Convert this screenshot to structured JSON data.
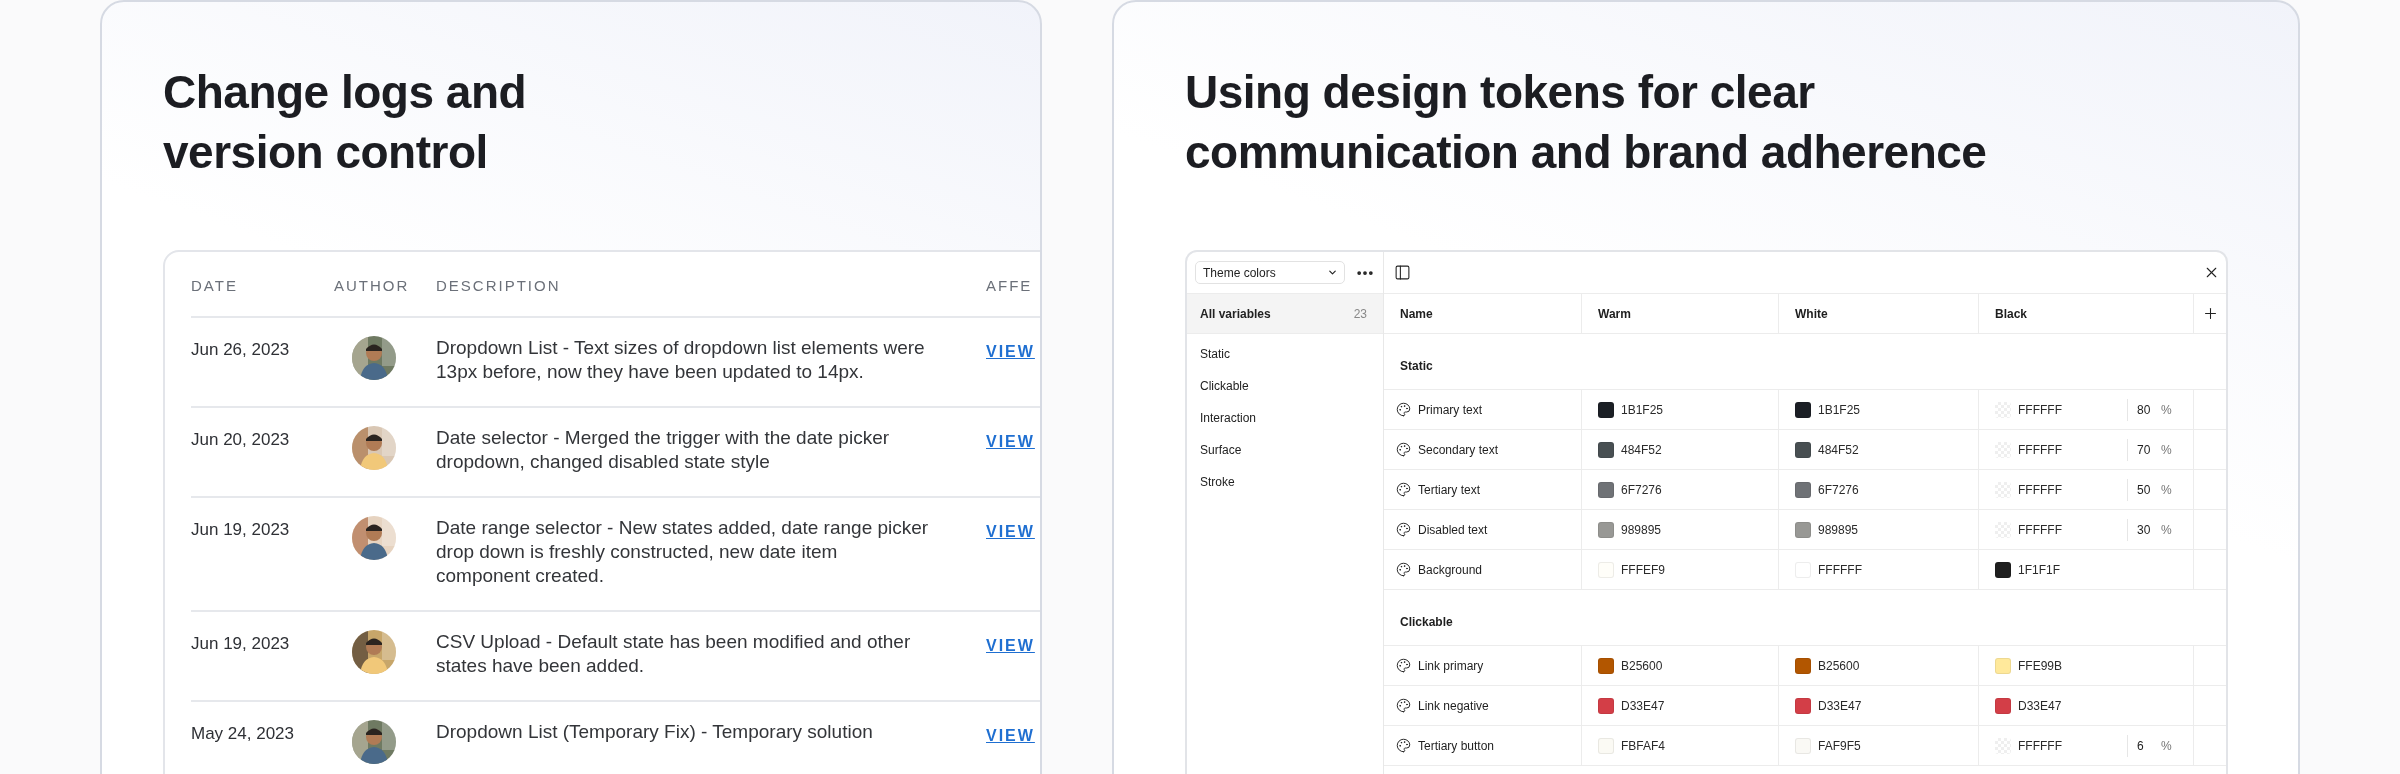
{
  "changelog": {
    "title": [
      "Change logs and",
      "version control"
    ],
    "columns": [
      "DATE",
      "AUTHOR",
      "DESCRIPTION",
      "AFFE"
    ],
    "rows": [
      {
        "date": "Jun 26, 2023",
        "description": "Dropdown List - Text sizes of dropdown list elements were 13px before, now they have been updated to 14px.",
        "link": "VIEW"
      },
      {
        "date": "Jun 20, 2023",
        "description": "Date selector - Merged the trigger with the date picker dropdown, changed disabled state style",
        "link": "VIEW"
      },
      {
        "date": "Jun 19, 2023",
        "description": "Date range selector - New states added, date range picker drop down is freshly constructed, new date item component created.",
        "link": "VIEW"
      },
      {
        "date": "Jun 19, 2023",
        "description": "CSV Upload - Default state has been modified and other states have been added.",
        "link": "VIEW"
      },
      {
        "date": "May 24, 2023",
        "description": "Dropdown List (Temporary Fix) - Temporary solution",
        "link": "VIEW"
      }
    ]
  },
  "tokens": {
    "title": [
      "Using design tokens for clear",
      "communication and brand adherence"
    ],
    "collection": "Theme colors",
    "sidebar": [
      {
        "label": "All variables",
        "count": "23",
        "selected": true
      },
      {
        "label": "Static",
        "selected": false
      },
      {
        "label": "Clickable",
        "selected": false
      },
      {
        "label": "Interaction",
        "selected": false
      },
      {
        "label": "Surface",
        "selected": false
      },
      {
        "label": "Stroke",
        "selected": false
      }
    ],
    "columns": [
      "Name",
      "Warm",
      "White",
      "Black"
    ],
    "groups": [
      {
        "title": "Static",
        "rows": [
          {
            "name": "Primary text",
            "values": [
              {
                "hex": "1B1F25",
                "color": "#1b1f25"
              },
              {
                "hex": "1B1F25",
                "color": "#1b1f25"
              },
              {
                "hex": "FFFFFF",
                "alpha": "80",
                "unit": "%"
              }
            ]
          },
          {
            "name": "Secondary text",
            "values": [
              {
                "hex": "484F52",
                "color": "#484f52"
              },
              {
                "hex": "484F52",
                "color": "#484f52"
              },
              {
                "hex": "FFFFFF",
                "alpha": "70",
                "unit": "%"
              }
            ]
          },
          {
            "name": "Tertiary text",
            "values": [
              {
                "hex": "6F7276",
                "color": "#6f7276"
              },
              {
                "hex": "6F7276",
                "color": "#6f7276"
              },
              {
                "hex": "FFFFFF",
                "alpha": "50",
                "unit": "%"
              }
            ]
          },
          {
            "name": "Disabled text",
            "values": [
              {
                "hex": "989895",
                "color": "#989895"
              },
              {
                "hex": "989895",
                "color": "#989895"
              },
              {
                "hex": "FFFFFF",
                "alpha": "30",
                "unit": "%"
              }
            ]
          },
          {
            "name": "Background",
            "values": [
              {
                "hex": "FFFEF9",
                "color": "#fffef9"
              },
              {
                "hex": "FFFFFF",
                "color": "#ffffff"
              },
              {
                "hex": "1F1F1F",
                "color": "#1f1f1f"
              }
            ]
          }
        ]
      },
      {
        "title": "Clickable",
        "rows": [
          {
            "name": "Link primary",
            "values": [
              {
                "hex": "B25600",
                "color": "#b25600"
              },
              {
                "hex": "B25600",
                "color": "#b25600"
              },
              {
                "hex": "FFE99B",
                "color": "#ffe99b"
              }
            ]
          },
          {
            "name": "Link negative",
            "values": [
              {
                "hex": "D33E47",
                "color": "#d33e47"
              },
              {
                "hex": "D33E47",
                "color": "#d33e47"
              },
              {
                "hex": "D33E47",
                "color": "#d33e47"
              }
            ]
          },
          {
            "name": "Tertiary button",
            "values": [
              {
                "hex": "FBFAF4",
                "color": "#fbfaf4"
              },
              {
                "hex": "FAF9F5",
                "color": "#faf9f5"
              },
              {
                "hex": "FFFFFF",
                "alpha": "6",
                "unit": "%"
              }
            ]
          }
        ]
      }
    ]
  }
}
